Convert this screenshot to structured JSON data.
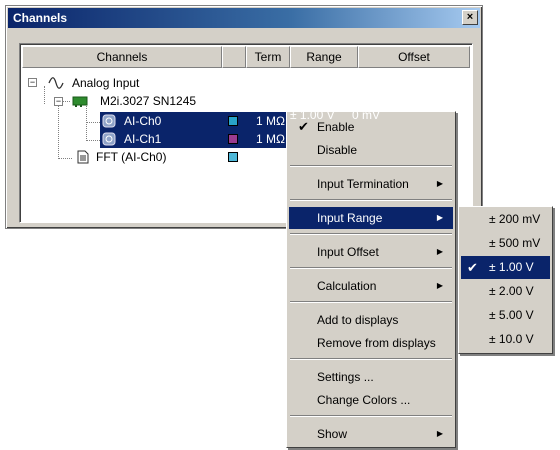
{
  "window": {
    "title": "Channels",
    "close_glyph": "×"
  },
  "columns": [
    "Channels",
    "",
    "Term",
    "Range",
    "Offset"
  ],
  "tree": {
    "root": "Analog Input",
    "device": "M2i.3027 SN1245",
    "channels": [
      {
        "name": "AI-Ch0",
        "term": "1 MΩ",
        "color": "#29a3c8"
      },
      {
        "name": "AI-Ch1",
        "term": "1 MΩ",
        "color": "#9a3c8f"
      }
    ],
    "fft": {
      "name": "FFT (AI-Ch0)",
      "color": "#4fb8d8"
    },
    "partial_range_text": "± 1.00 V",
    "partial_offset_text": "0 mV"
  },
  "context_menu": {
    "items": [
      {
        "label": "Enable",
        "checked": true
      },
      {
        "label": "Disable"
      },
      {
        "label": "Input Termination",
        "submenu": true
      },
      {
        "label": "Input Range",
        "submenu": true,
        "highlighted": true
      },
      {
        "label": "Input Offset",
        "submenu": true
      },
      {
        "label": "Calculation",
        "submenu": true
      },
      {
        "label": "Add to displays"
      },
      {
        "label": "Remove from displays"
      },
      {
        "label": "Settings ..."
      },
      {
        "label": "Change Colors ..."
      },
      {
        "label": "Show",
        "submenu": true
      }
    ]
  },
  "range_submenu": {
    "options": [
      "± 200 mV",
      "± 500 mV",
      "± 1.00 V",
      "± 2.00 V",
      "± 5.00 V",
      "± 10.0 V"
    ],
    "selected": "± 1.00 V"
  },
  "colors": {
    "selection": "#0a246a",
    "face": "#d4d0c8"
  }
}
